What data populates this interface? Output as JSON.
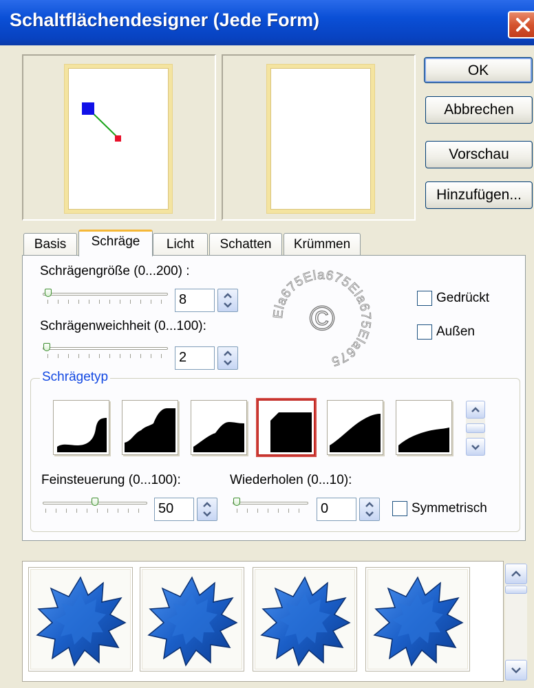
{
  "window": {
    "title": "Schaltflächendesigner (Jede Form)",
    "close_icon": "close-x-icon"
  },
  "buttons": {
    "ok": "OK",
    "cancel": "Abbrechen",
    "preview": "Vorschau",
    "add": "Hinzufügen..."
  },
  "tabs": [
    {
      "label": "Basis"
    },
    {
      "label": "Schräge",
      "active": true
    },
    {
      "label": "Licht"
    },
    {
      "label": "Schatten"
    },
    {
      "label": "Krümmen"
    }
  ],
  "bevel": {
    "size_label": "Schrägengröße (0...200) :",
    "size_value": "8",
    "size_level": 0.04,
    "softness_label": "Schrägenweichheit (0...100):",
    "softness_value": "2",
    "softness_level": 0.02,
    "pressed_label": "Gedrückt",
    "outside_label": "Außen",
    "type_label": "Schrägetyp",
    "fine_label": "Feinsteuerung (0...100):",
    "fine_value": "50",
    "fine_level": 0.5,
    "repeat_label": "Wiederholen (0...10):",
    "repeat_value": "0",
    "repeat_level": 0.0,
    "symmetric_label": "Symmetrisch",
    "selected_type_index": 3
  },
  "watermark": {
    "ring_text": "Ela675Ela675Ela675Ela675",
    "symbol": "©"
  },
  "colors": {
    "title_bar": "#0a4fd6",
    "accent_tab": "#f5b839",
    "selection": "#c22b26",
    "preset_blue": "#1b5fc8"
  }
}
